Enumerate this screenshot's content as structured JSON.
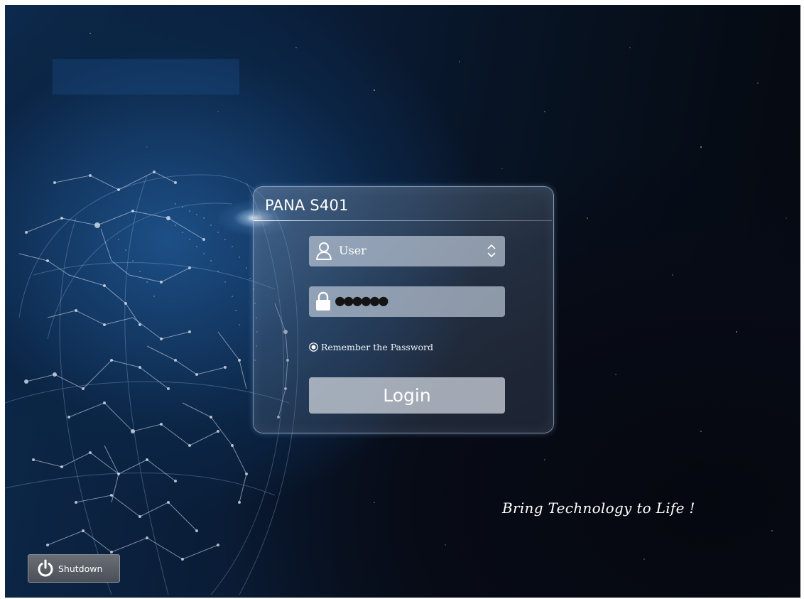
{
  "panel": {
    "title": "PANA S401"
  },
  "user_field": {
    "value": "User",
    "icon": "user-icon",
    "control_icon": "spin-updown-icon"
  },
  "password_field": {
    "value": "●●●●●●",
    "icon": "lock-icon"
  },
  "remember": {
    "label": "Remember the Password",
    "checked": true
  },
  "login": {
    "label": "Login"
  },
  "slogan": "Bring Technology to Life !",
  "shutdown": {
    "label": "Shutdown",
    "icon": "power-icon"
  },
  "colors": {
    "background_dark": "#05070c",
    "background_blue": "#143a66",
    "panel_border": "#c8dcf5",
    "field_fill": "#b9c3d2",
    "button_fill": "#c8ced7"
  }
}
